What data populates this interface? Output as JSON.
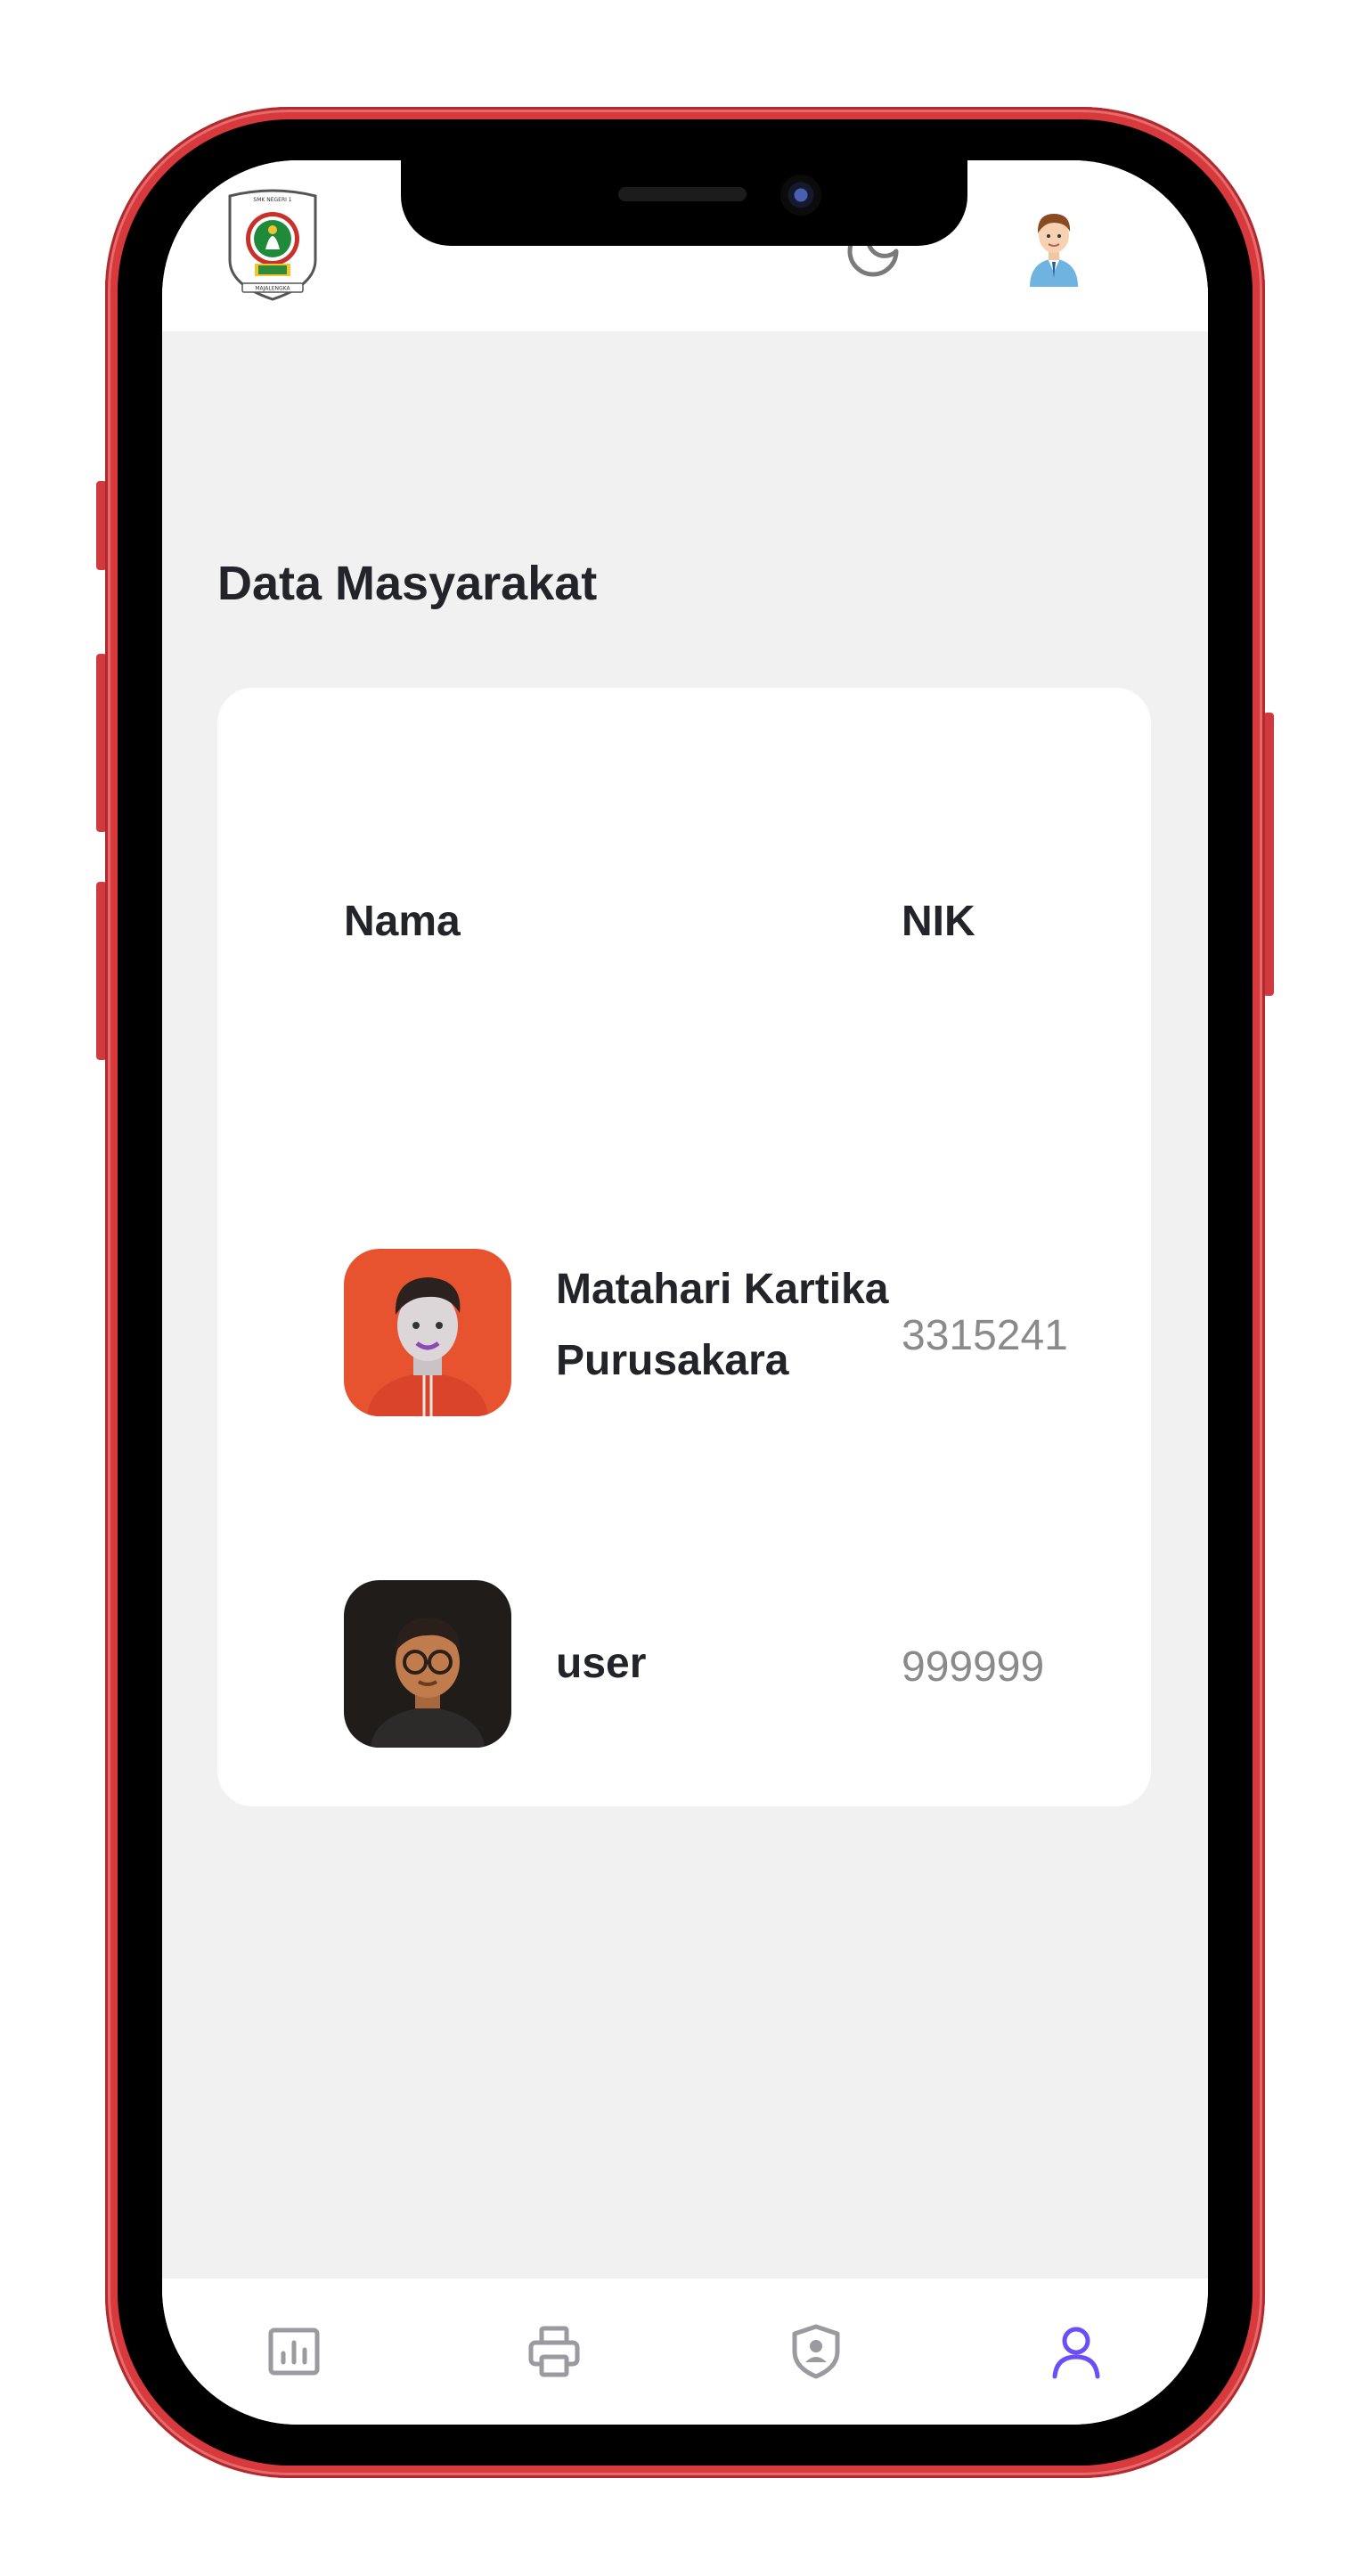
{
  "app": {
    "header": {
      "logo_icon": "school-crest-logo",
      "theme_icon": "moon-icon",
      "profile_icon": "user-avatar-illustration"
    },
    "page_title": "Data Masyarakat",
    "table": {
      "columns": [
        "Nama",
        "NIK"
      ],
      "rows": [
        {
          "name": "Matahari Kartika Purusakara",
          "nik": "3315241",
          "avatar_color": "#e7532f"
        },
        {
          "name": "user",
          "nik": "999999",
          "avatar_color": "#1f1c1a"
        }
      ]
    },
    "bottom_nav": [
      {
        "icon": "chart-icon",
        "active": false
      },
      {
        "icon": "printer-icon",
        "active": false
      },
      {
        "icon": "shield-user-icon",
        "active": false
      },
      {
        "icon": "user-icon",
        "active": true
      }
    ],
    "colors": {
      "phone_frame": "#d8393d",
      "screen_bg": "#f1f1f1",
      "accent": "#6c4ef6",
      "nav_inactive": "#9a9aa0",
      "text_primary": "#23232a",
      "text_secondary": "#8a8a8a"
    }
  }
}
